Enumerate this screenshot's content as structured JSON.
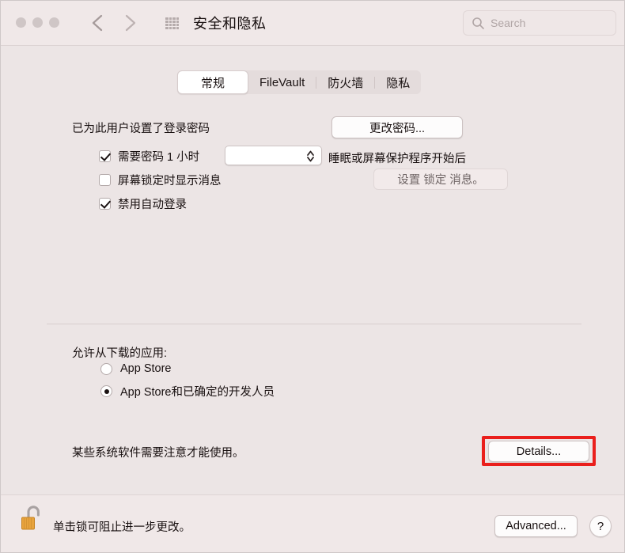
{
  "window": {
    "title": "安全和隐私",
    "background_color": "#ece5e5"
  },
  "titlebar": {
    "grid_icon": "grid-apps-icon",
    "back_icon": "chevron-left-icon",
    "forward_icon": "chevron-right-icon",
    "search": {
      "placeholder": "Search",
      "value": "",
      "icon": "search-icon"
    }
  },
  "tabs": [
    {
      "label": "常规",
      "selected": true
    },
    {
      "label": "FileVault",
      "selected": false
    },
    {
      "label": "防火墙",
      "selected": false
    },
    {
      "label": "隐私",
      "selected": false
    }
  ],
  "general": {
    "password_status": "已为此用户设置了登录密码",
    "change_password_button": "更改密码...",
    "require_password": {
      "label": "需要密码 1 小时",
      "checked": true,
      "interval_value": "",
      "trailing_label": "睡眠或屏幕保护程序开始后"
    },
    "show_message": {
      "label": "屏幕锁定时显示消息",
      "checked": false
    },
    "set_lock_message_button": "设置 锁定 消息。",
    "disable_auto_login": {
      "label": "禁用自动登录",
      "checked": true
    }
  },
  "downloads": {
    "heading": "允许从下载的应用:",
    "options": [
      {
        "label": "App Store",
        "selected": false
      },
      {
        "label": "App Store和已确定的开发人员",
        "selected": true
      }
    ],
    "notice": "某些系统软件需要注意才能使用。",
    "details_button": "Details...",
    "highlight_color": "#ea1f1c"
  },
  "bottom": {
    "lock_icon": "padlock-open-icon",
    "lock_text": "单击锁可阻止进一步更改。",
    "advanced_button": "Advanced...",
    "help_button": "?"
  }
}
